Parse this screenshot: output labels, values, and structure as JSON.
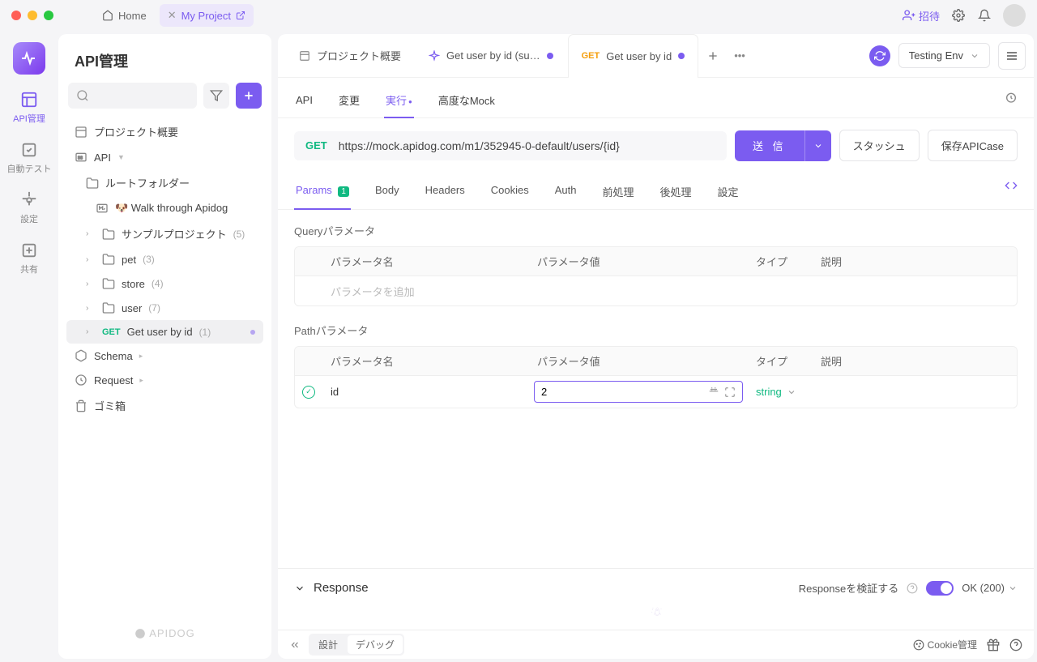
{
  "titlebar": {
    "home": "Home",
    "project": "My Project",
    "invite": "招待"
  },
  "leftbar": {
    "api_mgmt": "API管理",
    "auto_test": "自動テスト",
    "settings": "設定",
    "share": "共有"
  },
  "sidebar": {
    "title": "API管理",
    "project_overview": "プロジェクト概要",
    "api_root": "API",
    "root_folder": "ルートフォルダー",
    "walk_through": "🐶 Walk through Apidog",
    "sample_project": "サンプルプロジェクト",
    "sample_count": "(5)",
    "pet": "pet",
    "pet_count": "(3)",
    "store": "store",
    "store_count": "(4)",
    "user": "user",
    "user_count": "(7)",
    "get_user": "Get user by id",
    "get_user_count": "(1)",
    "schema": "Schema",
    "request": "Request",
    "trash": "ゴミ箱",
    "footer": "APIDOG"
  },
  "main_tabs": {
    "overview": "プロジェクト概要",
    "tab1": "Get user by id (su…",
    "tab2_method": "GET",
    "tab2_name": "Get user by id"
  },
  "env": {
    "name": "Testing Env"
  },
  "subtabs": {
    "api": "API",
    "change": "変更",
    "run": "実行",
    "mock": "高度なMock"
  },
  "request": {
    "method": "GET",
    "url": "https://mock.apidog.com/m1/352945-0-default/users/{id}",
    "send": "送 信",
    "stash": "スタッシュ",
    "save": "保存APICase"
  },
  "param_tabs": {
    "params": "Params",
    "params_count": "1",
    "body": "Body",
    "headers": "Headers",
    "cookies": "Cookies",
    "auth": "Auth",
    "pre": "前処理",
    "post": "後処理",
    "settings": "設定"
  },
  "query": {
    "title": "Queryパラメータ",
    "col_name": "パラメータ名",
    "col_value": "パラメータ値",
    "col_type": "タイプ",
    "col_desc": "説明",
    "add_placeholder": "パラメータを追加"
  },
  "path": {
    "title": "Pathパラメータ",
    "col_name": "パラメータ名",
    "col_value": "パラメータ値",
    "col_type": "タイプ",
    "col_desc": "説明",
    "param_name": "id",
    "param_value": "2",
    "param_type": "string"
  },
  "response": {
    "title": "Response",
    "validate": "Responseを検証する",
    "status": "OK (200)"
  },
  "footer": {
    "design": "設計",
    "debug": "デバッグ",
    "cookie": "Cookie管理"
  }
}
